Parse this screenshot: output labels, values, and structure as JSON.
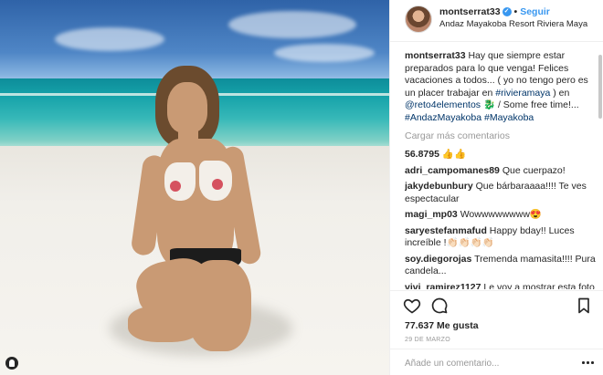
{
  "post": {
    "username": "montserrat33",
    "verified_glyph": "✓",
    "separator": "•",
    "follow_label": "Seguir",
    "location": "Andaz Mayakoba Resort Riviera Maya"
  },
  "caption": {
    "username": "montserrat33",
    "text_1": "Hay que siempre estar preparados para lo que venga! Felices vacaciones a todos... ( yo no tengo pero es un placer trabajar en ",
    "hashtag_1": "#rivieramaya",
    "text_2": " ) en ",
    "mention_1": "@reto4elementos",
    "emoji_1": "🐉",
    "text_3": " / Some free time!... ",
    "hashtag_2": "#AndazMayakoba",
    "hashtag_3": "#Mayakoba"
  },
  "load_more_label": "Cargar más comentarios",
  "comments": [
    {
      "username": "56.8795",
      "text": "👍👍"
    },
    {
      "username": "adri_campomanes89",
      "text": "Que cuerpazo!"
    },
    {
      "username": "jakydebunbury",
      "text": "Que bárbaraaaa!!!! Te ves espectacular"
    },
    {
      "username": "magi_mp03",
      "text": "Wowwwwwwww😍"
    },
    {
      "username": "saryestefanmafud",
      "text": "Happy bday!! Luces increíble !👏🏻👏🏻👏🏻👏🏻"
    },
    {
      "username": "soy.diegorojas",
      "text": "Tremenda mamasita!!!! Pura candela..."
    },
    {
      "username": "vivi_ramirez1127",
      "text": "Le voy a mostrar esta foto a mi entrenador para que sepa cual es mi"
    }
  ],
  "icons": {
    "like": "heart-icon",
    "comment": "comment-icon",
    "save": "bookmark-icon",
    "more": "more-options-icon",
    "photo_tag": "user-tag-icon"
  },
  "likes_label": "77.637 Me gusta",
  "date_label": "29 DE MARZO",
  "add_comment_placeholder": "Añade un comentario...",
  "colors": {
    "accent": "#3897f0",
    "text": "#262626",
    "muted": "#999999",
    "link": "#003569",
    "border": "#efefef"
  }
}
